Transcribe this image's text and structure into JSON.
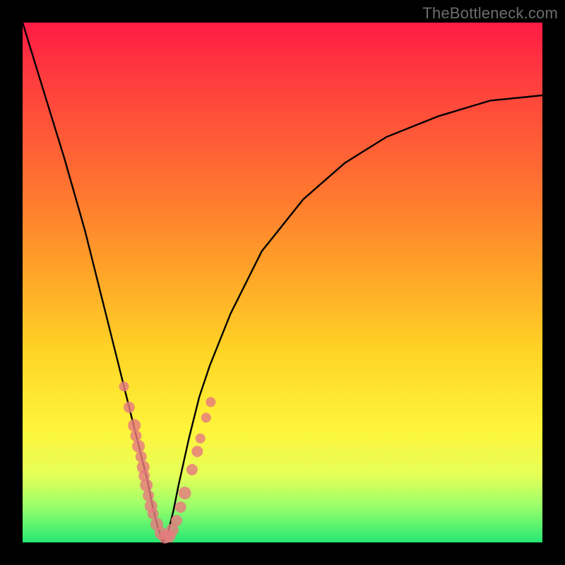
{
  "watermark": "TheBottleneck.com",
  "colors": {
    "frame": "#000000",
    "curve": "#000000",
    "dot": "#e77a7f",
    "gradient_stops": [
      "#ff1b44",
      "#ff3a3f",
      "#ff5a37",
      "#ff7a2f",
      "#ffa428",
      "#ffd626",
      "#fff43a",
      "#e6ff57",
      "#9bff6a",
      "#25e874"
    ]
  },
  "chart_data": {
    "type": "line",
    "title": "",
    "xlabel": "",
    "ylabel": "",
    "xlim": [
      0,
      100
    ],
    "ylim": [
      0,
      100
    ],
    "note": "Axes are unitless (no tick labels shown). y ≈ bottleneck %, minimum near x≈27. Values are estimated from pixel positions.",
    "series": [
      {
        "name": "bottleneck-curve",
        "x": [
          0,
          4,
          8,
          12,
          16,
          18,
          20,
          22,
          24,
          25,
          26,
          27,
          28,
          29,
          30,
          32,
          34,
          36,
          40,
          46,
          54,
          62,
          70,
          80,
          90,
          100
        ],
        "y": [
          100,
          87,
          74,
          60,
          44,
          36,
          28,
          20,
          12,
          7,
          3,
          0,
          2,
          6,
          11,
          20,
          28,
          34,
          44,
          56,
          66,
          73,
          78,
          82,
          85,
          86
        ]
      }
    ],
    "scatter": {
      "name": "sample-dots",
      "points": [
        {
          "x": 19.5,
          "y": 30,
          "r": 7
        },
        {
          "x": 20.5,
          "y": 26,
          "r": 8
        },
        {
          "x": 21.5,
          "y": 22.5,
          "r": 9
        },
        {
          "x": 21.8,
          "y": 20.5,
          "r": 8
        },
        {
          "x": 22.3,
          "y": 18.5,
          "r": 9
        },
        {
          "x": 22.8,
          "y": 16.5,
          "r": 8
        },
        {
          "x": 23.2,
          "y": 14.5,
          "r": 9
        },
        {
          "x": 23.4,
          "y": 12.8,
          "r": 8
        },
        {
          "x": 23.8,
          "y": 11,
          "r": 9
        },
        {
          "x": 24.2,
          "y": 9,
          "r": 8
        },
        {
          "x": 24.7,
          "y": 7,
          "r": 9
        },
        {
          "x": 25.1,
          "y": 5.5,
          "r": 8
        },
        {
          "x": 25.8,
          "y": 3.5,
          "r": 9
        },
        {
          "x": 26.6,
          "y": 1.8,
          "r": 9
        },
        {
          "x": 27.4,
          "y": 1.0,
          "r": 9
        },
        {
          "x": 28.2,
          "y": 1.2,
          "r": 9
        },
        {
          "x": 28.8,
          "y": 2.4,
          "r": 9
        },
        {
          "x": 29.6,
          "y": 4.2,
          "r": 8
        },
        {
          "x": 30.4,
          "y": 6.8,
          "r": 8
        },
        {
          "x": 31.2,
          "y": 9.5,
          "r": 9
        },
        {
          "x": 32.6,
          "y": 14,
          "r": 8
        },
        {
          "x": 33.6,
          "y": 17.5,
          "r": 8
        },
        {
          "x": 34.2,
          "y": 20,
          "r": 7
        },
        {
          "x": 35.3,
          "y": 24,
          "r": 7
        },
        {
          "x": 36.2,
          "y": 27,
          "r": 7
        }
      ]
    }
  }
}
